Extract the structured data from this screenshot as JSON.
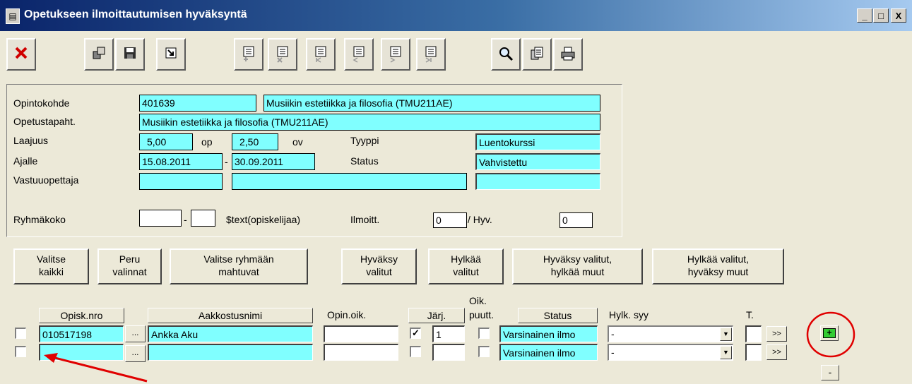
{
  "window": {
    "title": "Opetukseen ilmoittautumisen hyväksyntä",
    "minimize": "_",
    "maximize": "□",
    "close": "X"
  },
  "toolbar": {
    "icons": [
      "close-red-x-icon",
      "copy-record-icon",
      "save-disk-icon",
      "exit-arrow-icon",
      "add-row-icon",
      "delete-row-icon",
      "first-row-icon",
      "prev-row-icon",
      "next-row-icon",
      "last-row-icon",
      "search-magnifier-icon",
      "document-icon",
      "print-icon"
    ]
  },
  "info": {
    "opintokohde_label": "Opintokohde",
    "opintokohde_code": "401639",
    "opintokohde_name": "Musiikin estetiikka ja filosofia (TMU211AE)",
    "opetustapaht_label": "Opetustapaht.",
    "opetustapaht_value": "Musiikin estetiikka ja filosofia (TMU211AE)",
    "laajuus_label": "Laajuus",
    "laajuus_op": "5,00",
    "op_label": "op",
    "laajuus_ov": "2,50",
    "ov_label": "ov",
    "tyyppi_label": "Tyyppi",
    "tyyppi_value": "Luentokurssi",
    "ajalle_label": "Ajalle",
    "ajalle_start": "15.08.2011",
    "ajalle_dash": "-",
    "ajalle_end": "30.09.2011",
    "status_label": "Status",
    "status_value": "Vahvistettu",
    "vastuuopettaja_label": "Vastuuopettaja",
    "ryhmakoko_label": "Ryhmäkoko",
    "ryhmakoko_dash": "-",
    "opiskelijaa_text": "$text(opiskelijaa)",
    "ilmoitt_label": "Ilmoitt.",
    "ilmoitt_value": "0",
    "hyv_label": "/ Hyv.",
    "hyv_value": "0"
  },
  "actions": {
    "select_all": "Valitse\nkaikki",
    "cancel_selections": "Peru\nvalinnat",
    "select_fitting": "Valitse ryhmään\nmahtuvat",
    "approve_selected": "Hyväksy\nvalitut",
    "reject_selected": "Hylkää\nvalitut",
    "approve_reject_others": "Hyväksy valitut,\nhylkää muut",
    "reject_approve_others": "Hylkää valitut,\nhyväksy muut"
  },
  "grid": {
    "headers": {
      "opisk_nro": "Opisk.nro",
      "aakkostusnimi": "Aakkostusnimi",
      "opin_oik": "Opin.oik.",
      "jarj": "Järj.",
      "oik": "Oik.",
      "puutt": "puutt.",
      "status": "Status",
      "hylk_syy": "Hylk. syy",
      "t": "T."
    },
    "rows": [
      {
        "selected": false,
        "opisk_nro": "010517198",
        "dots": "...",
        "name": "Ankka Aku",
        "opin_oik": "",
        "jarj_checked": true,
        "jarj": "1",
        "puutt_checked": false,
        "status": "Varsinainen ilmo",
        "hylk_syy": "-",
        "t": "",
        "more": ">>"
      },
      {
        "selected": false,
        "opisk_nro": "",
        "dots": "...",
        "name": "",
        "opin_oik": "",
        "jarj_checked": false,
        "jarj": "",
        "puutt_checked": false,
        "status": "Varsinainen ilmo",
        "hylk_syy": "-",
        "t": "",
        "more": ">>"
      }
    ],
    "add_row": "+",
    "remove_row": "-"
  },
  "annotation": {
    "circle_color": "#e00000",
    "arrow_color": "#e00000"
  }
}
